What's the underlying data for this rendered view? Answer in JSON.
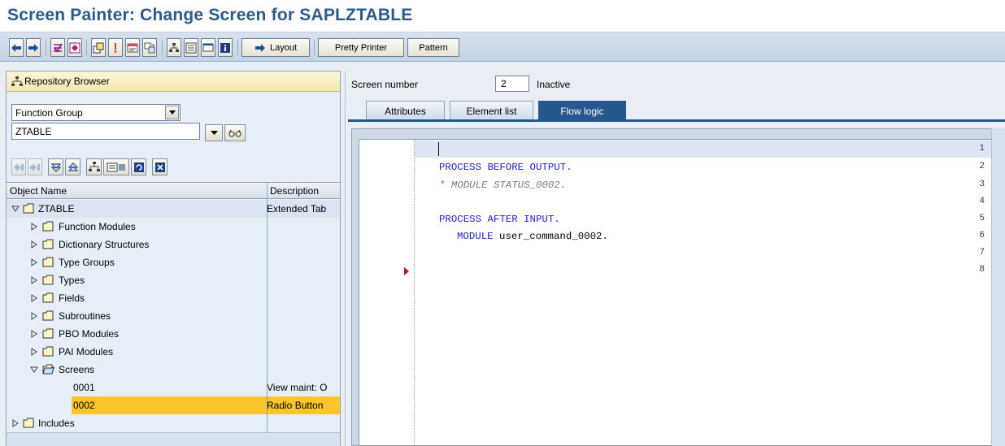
{
  "title": "Screen Painter: Change Screen for SAPLZTABLE",
  "toolbar": {
    "icons": [
      "back-icon",
      "forward-icon",
      "check-icon",
      "activate-icon",
      "where-used-icon",
      "display-change-icon",
      "dictionary-icon",
      "other-object-icon",
      "hierarchy-icon",
      "element-list-icon",
      "screen-icon",
      "info-icon"
    ],
    "layout_label": "Layout",
    "pretty_printer_label": "Pretty Printer",
    "pattern_label": "Pattern"
  },
  "repository": {
    "title": "Repository Browser",
    "object_type": "Function Group",
    "object_name": "ZTABLE",
    "columns": {
      "name": "Object Name",
      "description": "Description"
    },
    "root": {
      "label": "ZTABLE",
      "description": "Extended Tab"
    },
    "nodes": [
      {
        "label": "Function Modules"
      },
      {
        "label": "Dictionary Structures"
      },
      {
        "label": "Type Groups"
      },
      {
        "label": "Types"
      },
      {
        "label": "Fields"
      },
      {
        "label": "Subroutines"
      },
      {
        "label": "PBO Modules"
      },
      {
        "label": "PAI Modules"
      }
    ],
    "screens": {
      "label": "Screens",
      "items": [
        {
          "label": "0001",
          "description": "View maint: O"
        },
        {
          "label": "0002",
          "description": "Radio Button"
        }
      ]
    },
    "includes_label": "Includes"
  },
  "screen": {
    "number_label": "Screen number",
    "number": "2",
    "status": "Inactive",
    "tabs": [
      "Attributes",
      "Element list",
      "Flow logic"
    ],
    "active_tab": "Flow logic"
  },
  "editor": {
    "line_numbers": [
      "1",
      "2",
      "3",
      "4",
      "5",
      "6",
      "7",
      "8"
    ],
    "lines": [
      {
        "text": ""
      },
      {
        "text": "PROCESS BEFORE OUTPUT."
      },
      {
        "text": "* MODULE STATUS_0002."
      },
      {
        "text": ""
      },
      {
        "text": "PROCESS AFTER INPUT."
      },
      {
        "kw": "MODULE",
        "rest": " user_command_0002."
      },
      {
        "text": ""
      },
      {
        "text": ""
      }
    ]
  },
  "colors": {
    "title": "#2c5a8d",
    "keyword": "#1f26c8",
    "comment": "#7a7a7a",
    "selection": "#fcc52b",
    "active_tab": "#27588d"
  }
}
